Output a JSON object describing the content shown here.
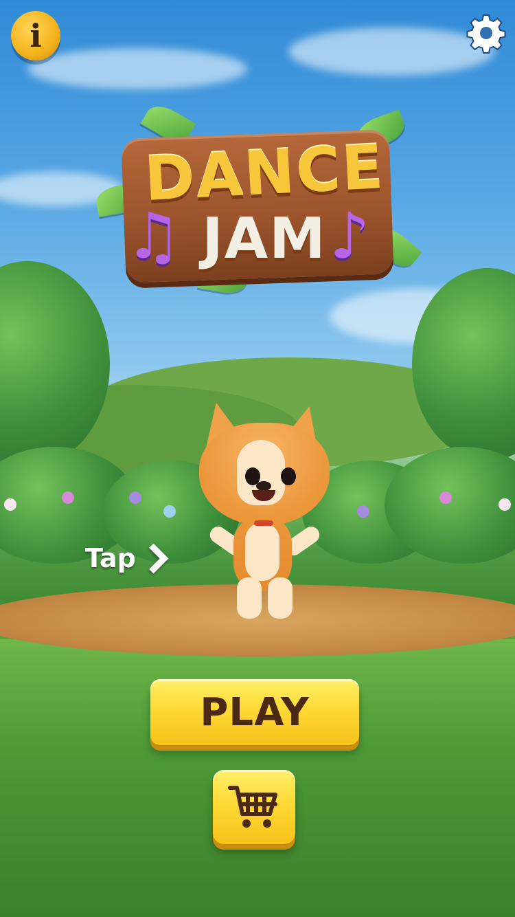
{
  "game": {
    "logo": {
      "line1": "DANCE",
      "line2": "JAM"
    },
    "info_button": {
      "label": "i"
    },
    "tap_hint": {
      "label": "Tap"
    },
    "play_button": {
      "label": "PLAY"
    },
    "icons": {
      "info": "info-icon",
      "settings": "gear-icon",
      "shop": "shopping-cart-icon",
      "tap_arrow": "chevron-right-icon"
    },
    "colors": {
      "button_yellow": "#ffd936",
      "button_text": "#4a2a14",
      "logo_gold": "#f7c63b",
      "note_purple": "#b764e6"
    }
  }
}
